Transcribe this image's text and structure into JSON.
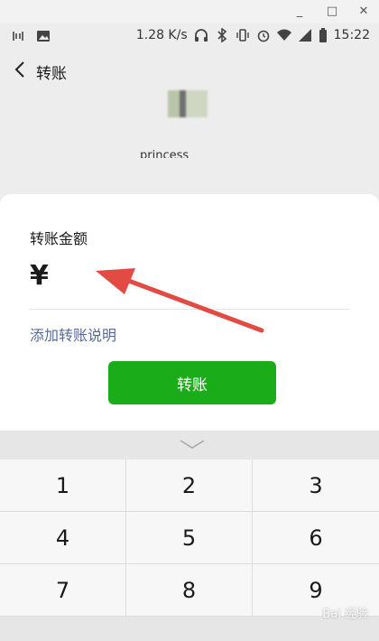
{
  "window": {
    "minimize": "_",
    "maximize": "□",
    "close": "✕"
  },
  "status_bar": {
    "speed": "1.28 K/s",
    "time": "15:22"
  },
  "nav": {
    "title": "转账"
  },
  "recipient": {
    "name": "princess"
  },
  "sheet": {
    "amount_label": "转账金额",
    "currency": "¥",
    "amount_value": "",
    "add_note": "添加转账说明",
    "transfer_button": "转账"
  },
  "keypad": {
    "keys": [
      "1",
      "2",
      "3",
      "4",
      "5",
      "6",
      "7",
      "8",
      "9"
    ]
  },
  "watermark": "Bai 经验",
  "colors": {
    "accent": "#1aad19",
    "link": "#576b95",
    "arrow": "#e24a44"
  }
}
